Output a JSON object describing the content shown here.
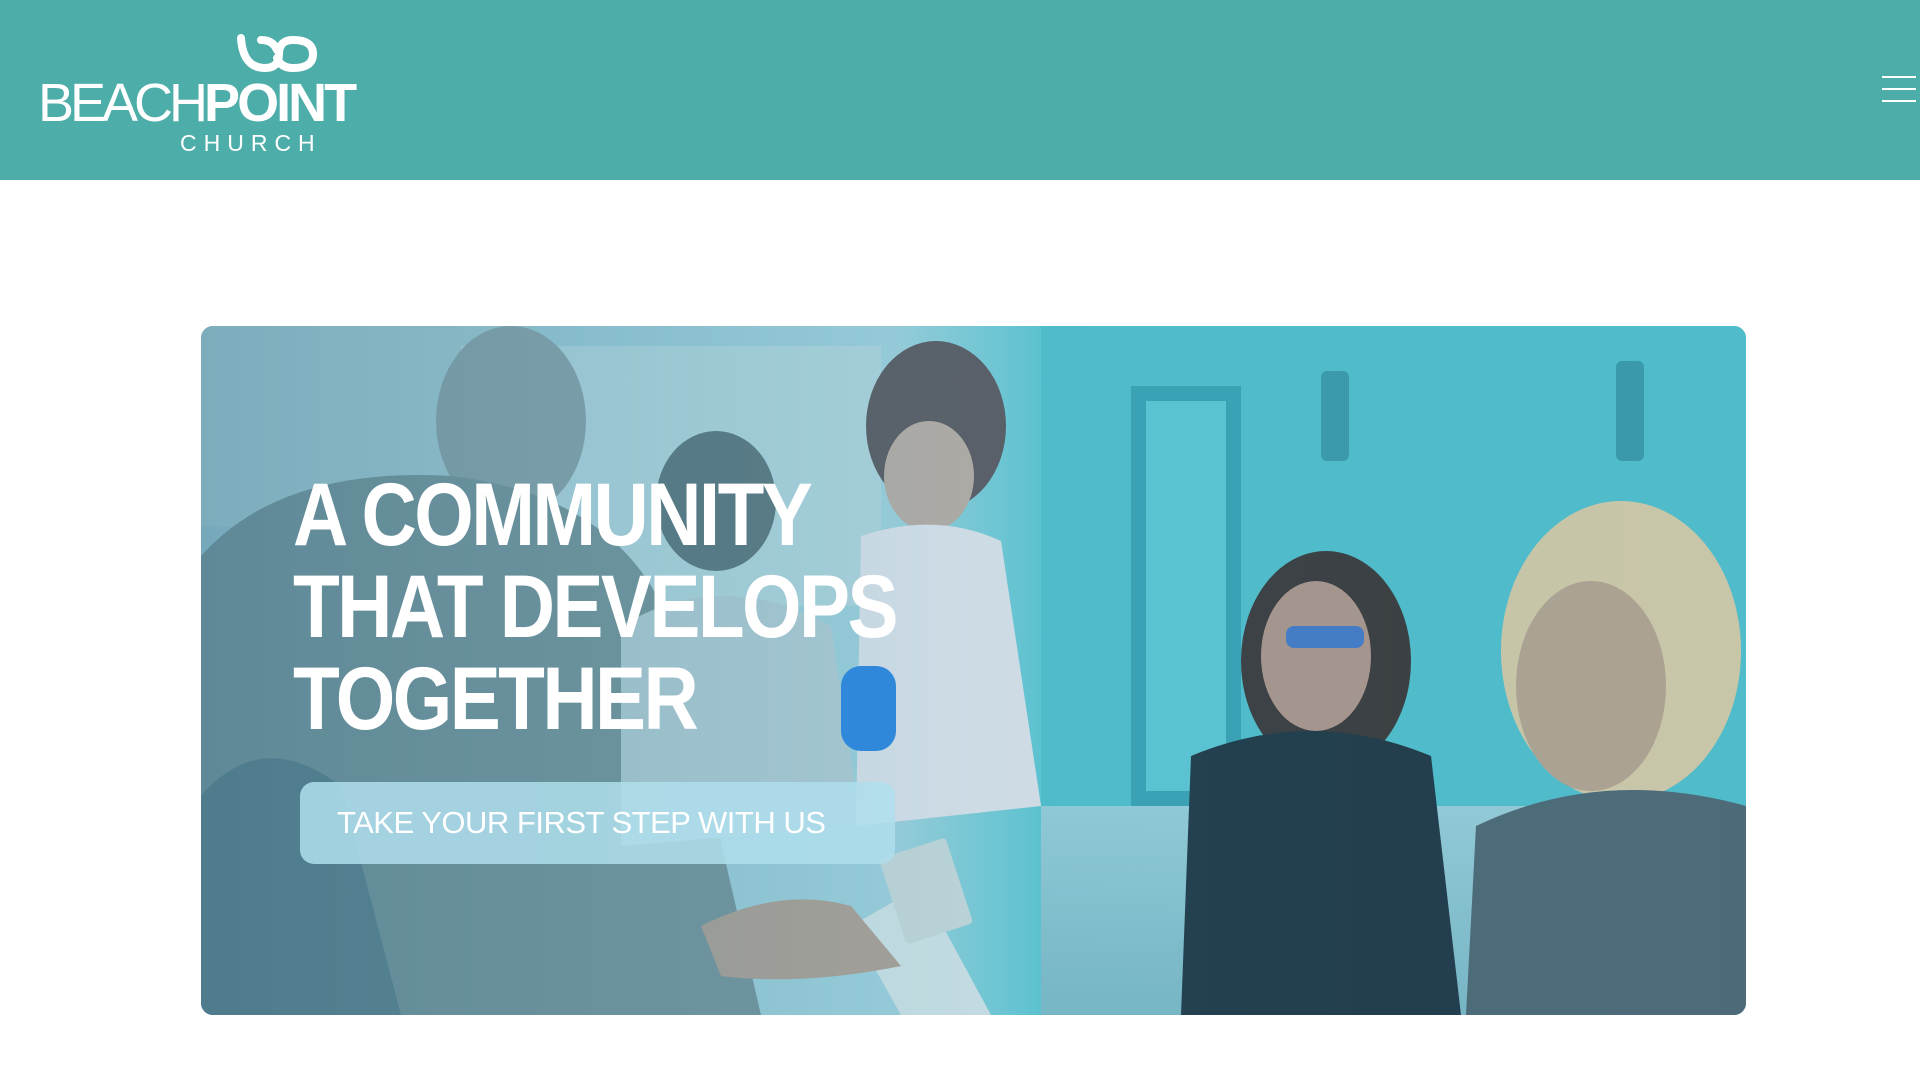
{
  "header": {
    "logo": {
      "word_light": "BEACH",
      "word_bold": "POINT",
      "sub": "CHURCH",
      "alt": "Beachpoint Church"
    },
    "menu_icon": "hamburger-menu-icon"
  },
  "hero": {
    "headline_lines": [
      "A COMMUNITY",
      "THAT DEVELOPS",
      "TOGETHER"
    ],
    "cta_label": "TAKE YOUR FIRST STEP WITH US"
  },
  "colors": {
    "header_bg": "#4dada9",
    "overlay_teal": "#3fb8c8",
    "cta_bg": "#afdeec",
    "text": "#ffffff"
  }
}
